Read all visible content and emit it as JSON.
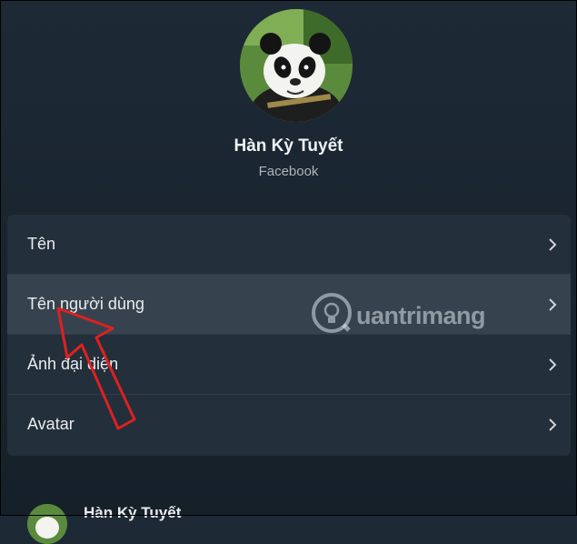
{
  "profile": {
    "name": "Hàn Kỳ Tuyết",
    "platform": "Facebook"
  },
  "menu": {
    "items": [
      {
        "label": "Tên",
        "icon": "chevron-right-icon"
      },
      {
        "label": "Tên người dùng",
        "icon": "chevron-right-icon",
        "active": true
      },
      {
        "label": "Ảnh đại diện",
        "icon": "chevron-right-icon"
      },
      {
        "label": "Avatar",
        "icon": "chevron-right-icon"
      }
    ]
  },
  "account": {
    "name": "Hàn Kỳ Tuyết"
  },
  "watermark": {
    "text": "uantrimang"
  },
  "colors": {
    "background": "#1a2530",
    "panel": "#232f3b",
    "active_row": "#36434f",
    "annotation_arrow": "#e02020"
  }
}
